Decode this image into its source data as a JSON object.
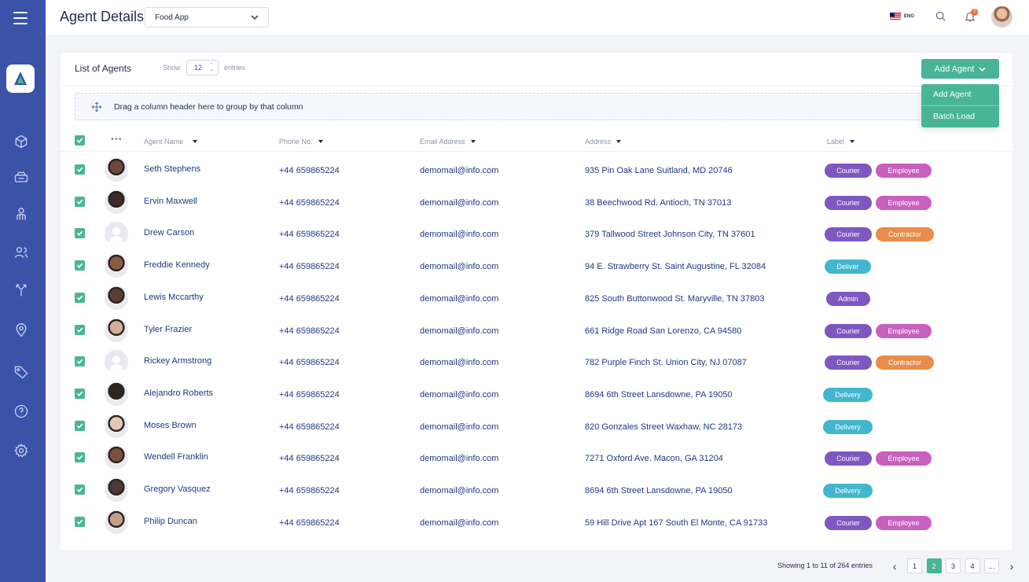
{
  "header": {
    "title": "Agent Details",
    "app_select": "Food App",
    "language": "ENG",
    "notification_count": "2"
  },
  "card": {
    "title": "List of Agents",
    "show_label": "Show",
    "show_value": "12",
    "entries_label": "entries",
    "add_button": "Add Agent",
    "dropdown": [
      "Add Agent",
      "Batch Load"
    ],
    "group_hint": "Drag a column header here to group by that column"
  },
  "columns": [
    "Agent Name",
    "Phone No.",
    "Email Address",
    "Address",
    "Label"
  ],
  "rows": [
    {
      "name": "Seth Stephens",
      "phone": "+44 659865224",
      "email": "demomail@info.com",
      "address": "935 Pin Oak Lane Suitland, MD 20746",
      "labels": [
        "Courier",
        "Employee"
      ],
      "avatar": "photo"
    },
    {
      "name": "Ervin Maxwell",
      "phone": "+44 659865224",
      "email": "demomail@info.com",
      "address": "38 Beechwood Rd. Antioch, TN 37013",
      "labels": [
        "Courier",
        "Employee"
      ],
      "avatar": "photo"
    },
    {
      "name": "Drew Carson",
      "phone": "+44 659865224",
      "email": "demomail@info.com",
      "address": "379 Tallwood Street Johnson City, TN 37601",
      "labels": [
        "Courier",
        "Contractor"
      ],
      "avatar": "placeholder"
    },
    {
      "name": "Freddie Kennedy",
      "phone": "+44 659865224",
      "email": "demomail@info.com",
      "address": "94 E. Strawberry St. Saint Augustine, FL 32084",
      "labels": [
        "Deliver"
      ],
      "avatar": "photo"
    },
    {
      "name": "Lewis Mccarthy",
      "phone": "+44 659865224",
      "email": "demomail@info.com",
      "address": "825 South Buttonwood St. Maryville, TN 37803",
      "labels": [
        "Admin"
      ],
      "avatar": "photo"
    },
    {
      "name": "Tyler Frazier",
      "phone": "+44 659865224",
      "email": "demomail@info.com",
      "address": "661 Ridge Road San Lorenzo, CA 94580",
      "labels": [
        "Courier",
        "Employee"
      ],
      "avatar": "photo"
    },
    {
      "name": "Rickey Armstrong",
      "phone": "+44 659865224",
      "email": "demomail@info.com",
      "address": "782 Purple Finch St. Union City, NJ 07087",
      "labels": [
        "Courier",
        "Contractor"
      ],
      "avatar": "placeholder"
    },
    {
      "name": "Alejandro Roberts",
      "phone": "+44 659865224",
      "email": "demomail@info.com",
      "address": "8694 6th Street Lansdowne, PA 19050",
      "labels": [
        "Delivery"
      ],
      "avatar": "photo"
    },
    {
      "name": "Moses Brown",
      "phone": "+44 659865224",
      "email": "demomail@info.com",
      "address": "820 Gonzales Street Waxhaw, NC 28173",
      "labels": [
        "Delivery"
      ],
      "avatar": "photo"
    },
    {
      "name": "Wendell Franklin",
      "phone": "+44 659865224",
      "email": "demomail@info.com",
      "address": "7271 Oxford Ave. Macon, GA 31204",
      "labels": [
        "Courier",
        "Employee"
      ],
      "avatar": "photo"
    },
    {
      "name": "Gregory Vasquez",
      "phone": "+44 659865224",
      "email": "demomail@info.com",
      "address": "8694 6th Street Lansdowne, PA 19050",
      "labels": [
        "Delivery"
      ],
      "avatar": "photo"
    },
    {
      "name": "Philip Duncan",
      "phone": "+44 659865224",
      "email": "demomail@info.com",
      "address": "59 Hill Drive Apt 167 South El Monte, CA 91733",
      "labels": [
        "Courier",
        "Employee"
      ],
      "avatar": "photo"
    }
  ],
  "label_colors": {
    "Courier": "#7e57c2",
    "Employee": "#c95fbf",
    "Contractor": "#e98c4c",
    "Deliver": "#43b6cf",
    "Delivery": "#43b6cf",
    "Admin": "#7e57c2"
  },
  "footer": {
    "showing": "Showing 1 to 11 of 264 entries",
    "pages": [
      "1",
      "2",
      "3",
      "4",
      "…"
    ],
    "active_page": "2"
  },
  "colors": {
    "sidebar": "#3a52a8",
    "accent": "#47b596"
  },
  "sidebar_icons": [
    "box-icon",
    "ticket-icon",
    "agent-icon",
    "users-icon",
    "routes-icon",
    "location-icon",
    "tag-icon",
    "help-icon",
    "settings-icon"
  ]
}
